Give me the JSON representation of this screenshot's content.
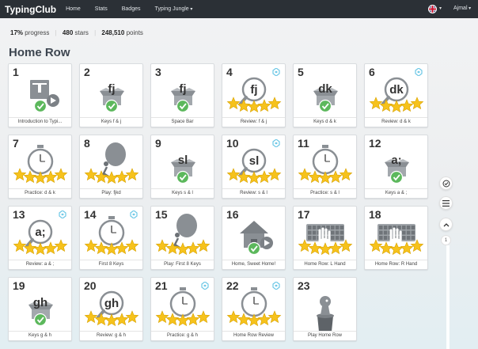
{
  "app": {
    "brand": "TypingClub",
    "nav": [
      "Home",
      "Stats",
      "Badges",
      "Typing Jungle"
    ],
    "user": "Ajmal"
  },
  "stats": {
    "progress_value": "17%",
    "progress_label": "progress",
    "stars_value": "480",
    "stars_label": "stars",
    "points_value": "248,510",
    "points_label": "points"
  },
  "section_title": "Home Row",
  "lessons": [
    {
      "num": "1",
      "caption": "Introduction to Typi...",
      "kind": "intro",
      "state": "check"
    },
    {
      "num": "2",
      "caption": "Keys f & j",
      "kind": "keys",
      "label": "fj",
      "state": "check"
    },
    {
      "num": "3",
      "caption": "Space Bar",
      "kind": "keys",
      "label": "fj",
      "state": "check"
    },
    {
      "num": "4",
      "caption": "Review: f & j",
      "kind": "review",
      "label": "fj",
      "state": "stars",
      "badge": true
    },
    {
      "num": "5",
      "caption": "Keys d & k",
      "kind": "keys",
      "label": "dk",
      "state": "check"
    },
    {
      "num": "6",
      "caption": "Review: d & k",
      "kind": "review",
      "label": "dk",
      "state": "stars",
      "badge": true
    },
    {
      "num": "7",
      "caption": "Practice: d & k",
      "kind": "timer",
      "state": "stars"
    },
    {
      "num": "8",
      "caption": "Play: fjkd",
      "kind": "play",
      "state": "stars"
    },
    {
      "num": "9",
      "caption": "Keys s & l",
      "kind": "keys",
      "label": "sl",
      "state": "check"
    },
    {
      "num": "10",
      "caption": "Review: s & l",
      "kind": "review",
      "label": "sl",
      "state": "stars",
      "badge": true
    },
    {
      "num": "11",
      "caption": "Practice: s & l",
      "kind": "timer",
      "state": "stars"
    },
    {
      "num": "12",
      "caption": "Keys a & ;",
      "kind": "keys",
      "label": "a;",
      "state": "check"
    },
    {
      "num": "13",
      "caption": "Review: a & ;",
      "kind": "review",
      "label": "a;",
      "state": "stars",
      "badge": true
    },
    {
      "num": "14",
      "caption": "First 8 Keys",
      "kind": "timer",
      "state": "stars",
      "badge": true
    },
    {
      "num": "15",
      "caption": "Play: First 8 Keys",
      "kind": "play",
      "state": "stars"
    },
    {
      "num": "16",
      "caption": "Home, Sweet Home!",
      "kind": "home",
      "state": "check"
    },
    {
      "num": "17",
      "caption": "Home Row: L Hand",
      "kind": "hand",
      "state": "stars"
    },
    {
      "num": "18",
      "caption": "Home Row: R Hand",
      "kind": "hand",
      "state": "stars"
    },
    {
      "num": "19",
      "caption": "Keys g & h",
      "kind": "keys",
      "label": "gh",
      "state": "check"
    },
    {
      "num": "20",
      "caption": "Review: g & h",
      "kind": "review",
      "label": "gh",
      "state": "stars"
    },
    {
      "num": "21",
      "caption": "Practice: g & h",
      "kind": "timer",
      "state": "stars",
      "badge": true
    },
    {
      "num": "22",
      "caption": "Home Row Review",
      "kind": "timer",
      "state": "stars",
      "badge": true
    },
    {
      "num": "23",
      "caption": "Play Home Row",
      "kind": "mascot",
      "state": "none"
    }
  ],
  "side_controls": {
    "page": "1"
  },
  "colors": {
    "topbar": "#2b3036",
    "star": "#f6c21c",
    "check": "#5cb85c",
    "icon_gray": "#8a8f94",
    "badge": "#6cc7e6"
  }
}
